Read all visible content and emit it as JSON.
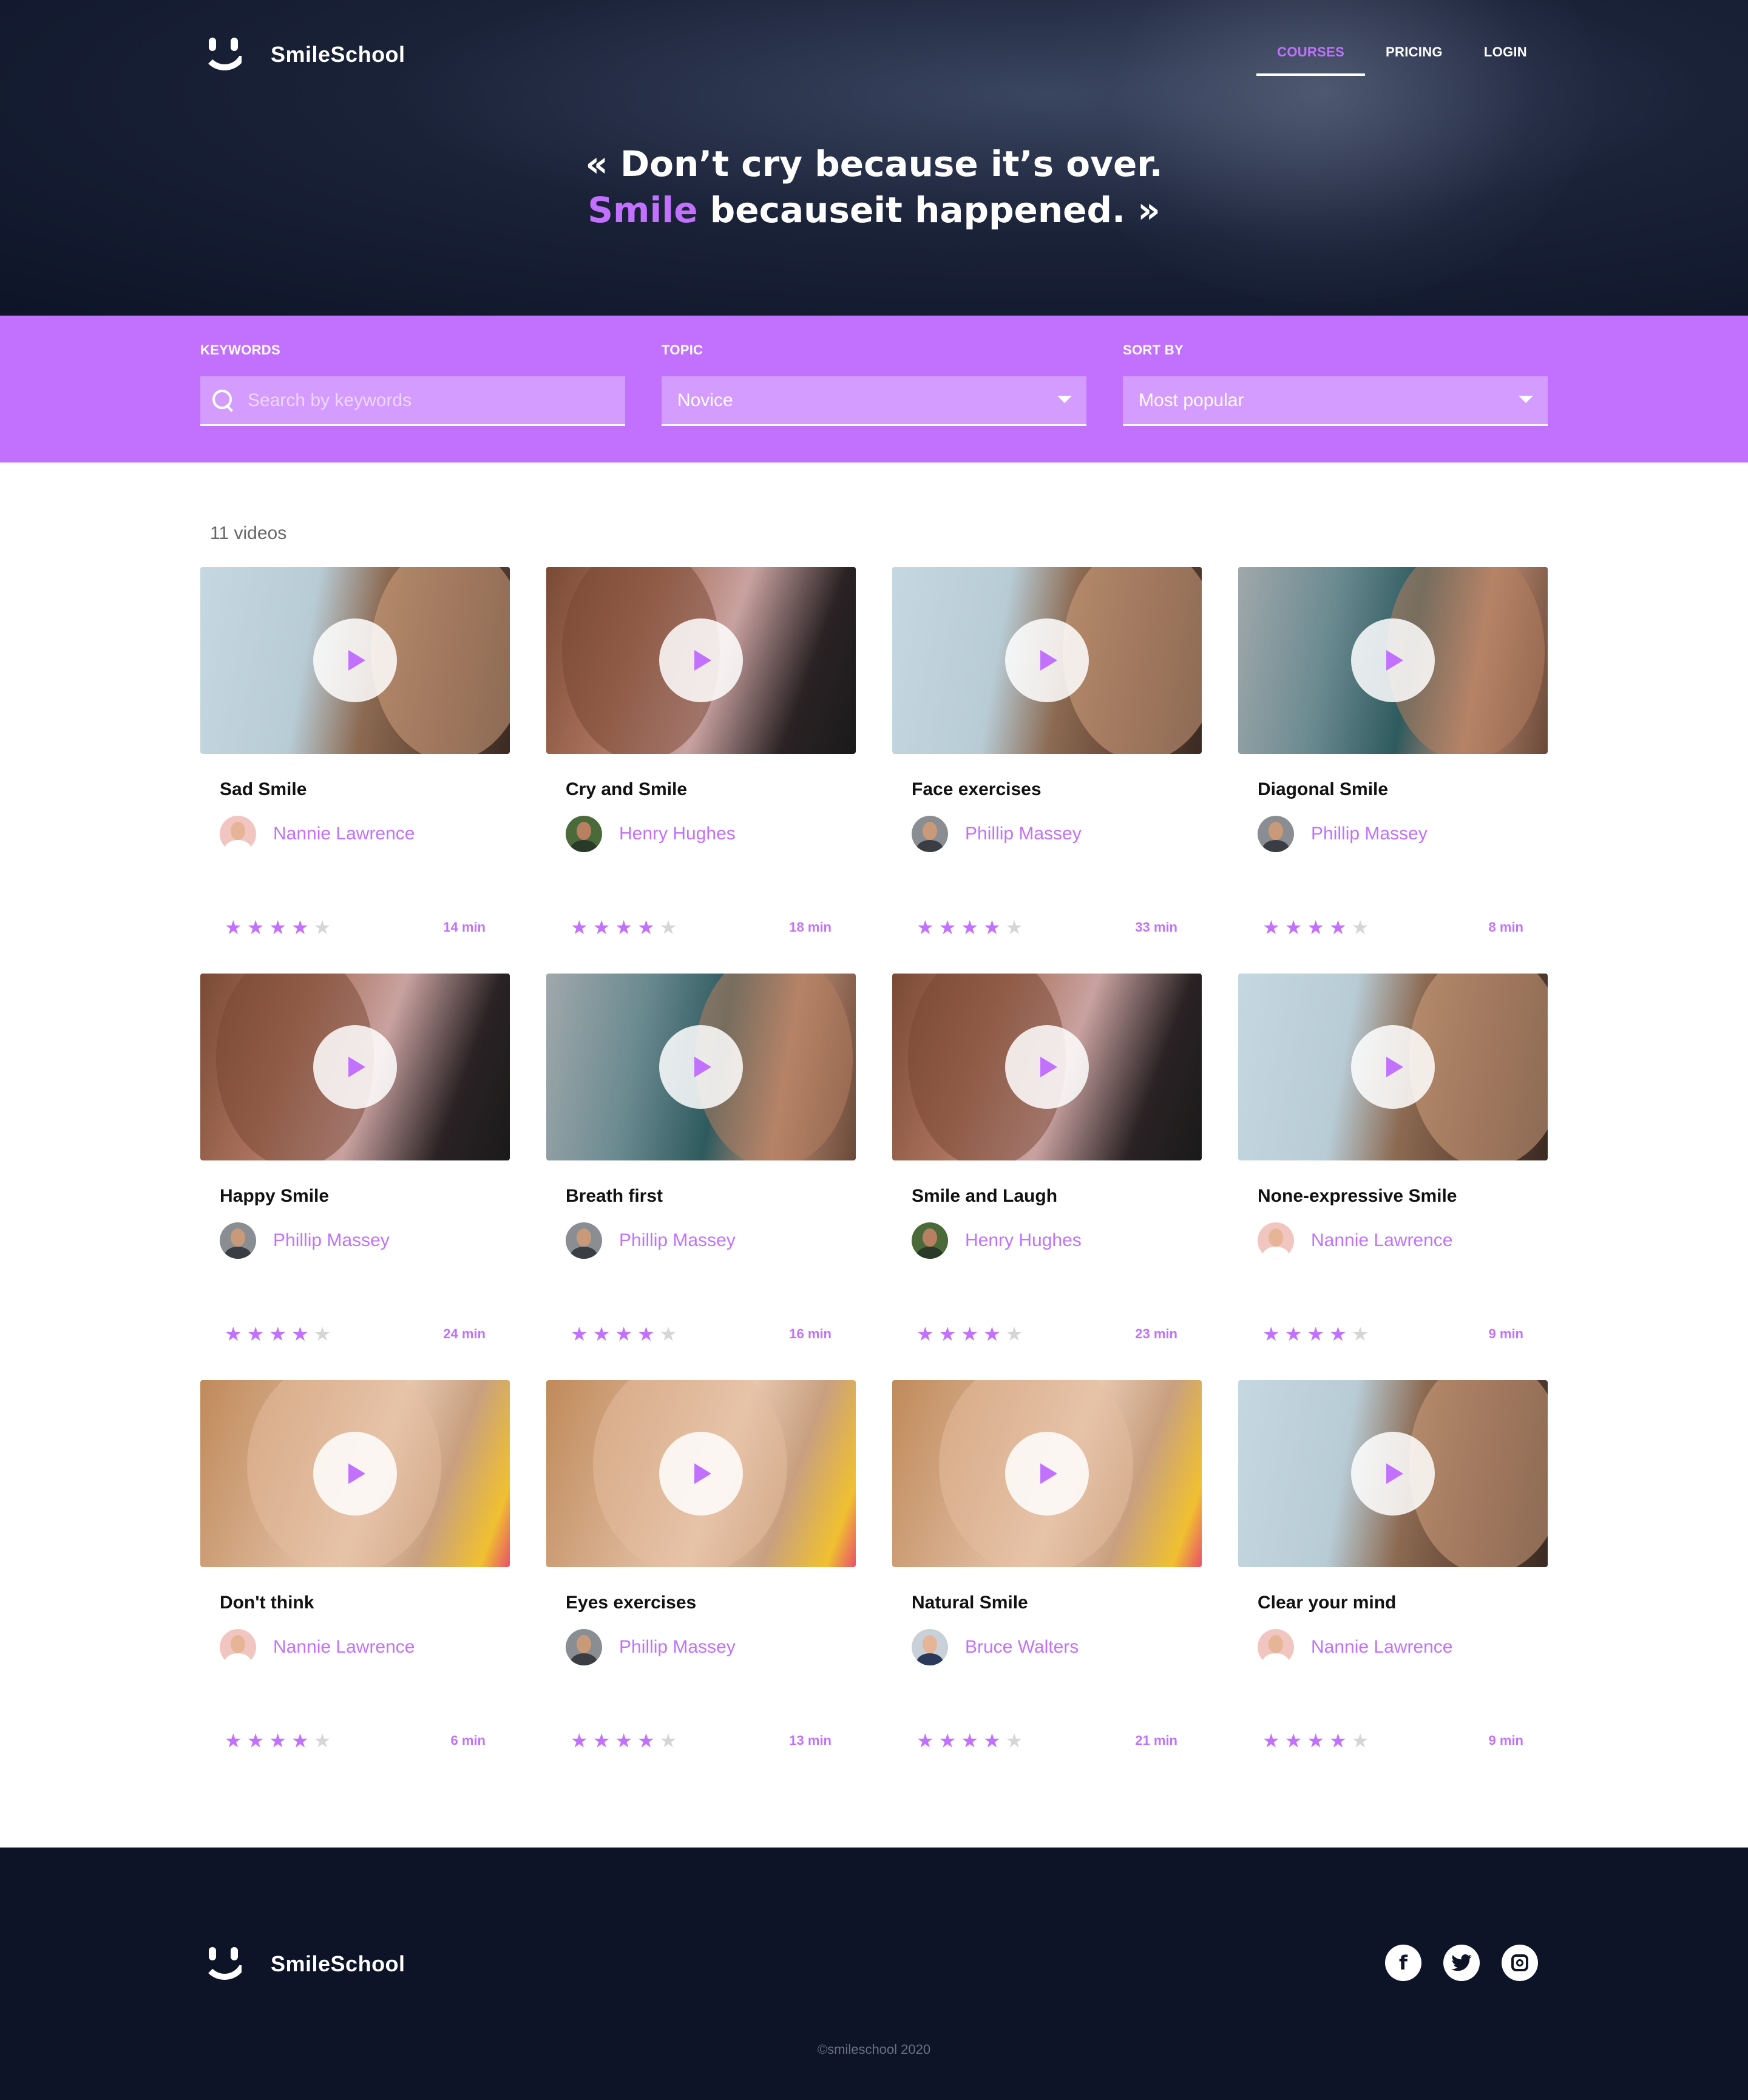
{
  "brand": {
    "name": "SmileSchool"
  },
  "nav": {
    "courses": "COURSES",
    "pricing": "PRICING",
    "login": "LOGIN"
  },
  "hero": {
    "line1": "« Don’t cry because it’s over.",
    "highlight": "Smile",
    "line2_rest": " becauseit happened. »"
  },
  "filters": {
    "keywords_label": "KEYWORDS",
    "keywords_placeholder": "Search by keywords",
    "topic_label": "TOPIC",
    "topic_value": "Novice",
    "sort_label": "SORT BY",
    "sort_value": "Most popular"
  },
  "results": {
    "count": "11 videos"
  },
  "cards": [
    {
      "title": "Sad Smile",
      "author": "Nannie Lawrence",
      "duration": "14 min",
      "rating": 4
    },
    {
      "title": "Cry and Smile",
      "author": "Henry Hughes",
      "duration": "18 min",
      "rating": 4
    },
    {
      "title": "Face exercises",
      "author": "Phillip Massey",
      "duration": "33 min",
      "rating": 4
    },
    {
      "title": "Diagonal Smile",
      "author": "Phillip Massey",
      "duration": "8 min",
      "rating": 4
    },
    {
      "title": "Happy Smile",
      "author": "Phillip Massey",
      "duration": "24 min",
      "rating": 4
    },
    {
      "title": "Breath first",
      "author": "Phillip Massey",
      "duration": "16 min",
      "rating": 4
    },
    {
      "title": "Smile and Laugh",
      "author": "Henry Hughes",
      "duration": "23 min",
      "rating": 4
    },
    {
      "title": "None-expressive Smile",
      "author": "Nannie Lawrence",
      "duration": "9 min",
      "rating": 4
    },
    {
      "title": "Don't think",
      "author": "Nannie Lawrence",
      "duration": "6 min",
      "rating": 4
    },
    {
      "title": "Eyes exercises",
      "author": "Phillip Massey",
      "duration": "13 min",
      "rating": 4
    },
    {
      "title": "Natural Smile",
      "author": "Bruce Walters",
      "duration": "21 min",
      "rating": 4
    },
    {
      "title": "Clear your mind",
      "author": "Nannie Lawrence",
      "duration": "9 min",
      "rating": 4
    }
  ],
  "footer": {
    "brand": "SmileSchool",
    "facebook": "f",
    "copyright": "©smileschool 2020"
  },
  "colors": {
    "accent": "#c271ff",
    "dark": "#0d1428"
  }
}
